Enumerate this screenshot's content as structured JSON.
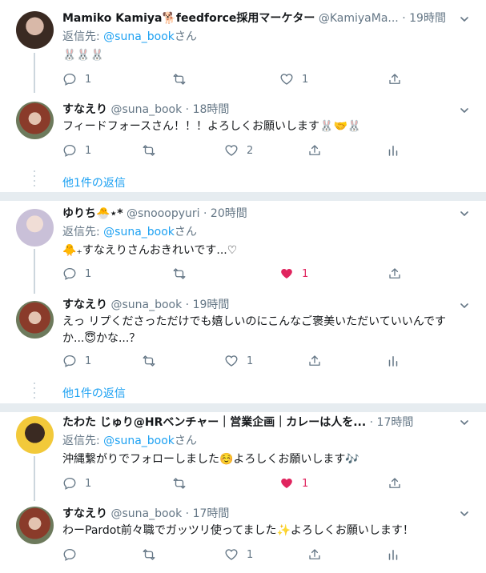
{
  "more_replies_label": "他1件の返信",
  "reply_prefix": "返信先: ",
  "reply_suffix": "さん",
  "colors": {
    "accent": "#1da1f2",
    "like": "#e0245e",
    "meta": "#657786"
  },
  "tweets": [
    {
      "name": "Mamiko Kamiya🐕feedforce採用マーケター",
      "handle": "@KamiyaMa...",
      "sep": "·",
      "time": "19時間",
      "reply_to": "@suna_book",
      "text": "🐰🐰🐰",
      "replies": "1",
      "retweets": "",
      "likes": "1",
      "liked": false
    },
    {
      "name": "すなえり",
      "handle": "@suna_book",
      "sep": "·",
      "time": "18時間",
      "text": "フィードフォースさん！！！よろしくお願いします🐰🤝🐰",
      "replies": "1",
      "retweets": "",
      "likes": "2",
      "liked": false
    },
    {
      "name": "ゆりち",
      "name_tail": "🐣⋆*",
      "handle": "@snooopyuri",
      "sep": "·",
      "time": "20時間",
      "reply_to": "@suna_book",
      "text": "🐥₊すなえりさんおきれいです...♡",
      "replies": "1",
      "retweets": "",
      "likes": "1",
      "liked": true
    },
    {
      "name": "すなえり",
      "handle": "@suna_book",
      "sep": "·",
      "time": "19時間",
      "text": "えっ リプくださっただけでも嬉しいのにこんなご褒美いただいていいんですか...😇かな...？",
      "replies": "1",
      "retweets": "",
      "likes": "1",
      "liked": false
    },
    {
      "name": "たわた じゅり@HRベンチャー｜営業企画｜カレーは人を...",
      "handle": "",
      "sep": "·",
      "time": "17時間",
      "reply_to": "@suna_book",
      "text": "沖縄繋がりでフォローしました☺️よろしくお願いします🎶",
      "replies": "1",
      "retweets": "",
      "likes": "1",
      "liked": true
    },
    {
      "name": "すなえり",
      "handle": "@suna_book",
      "sep": "·",
      "time": "17時間",
      "text": "わーPardot前々職でガッツリ使ってました✨よろしくお願いします！",
      "replies": "",
      "retweets": "",
      "likes": "1",
      "liked": false
    }
  ]
}
